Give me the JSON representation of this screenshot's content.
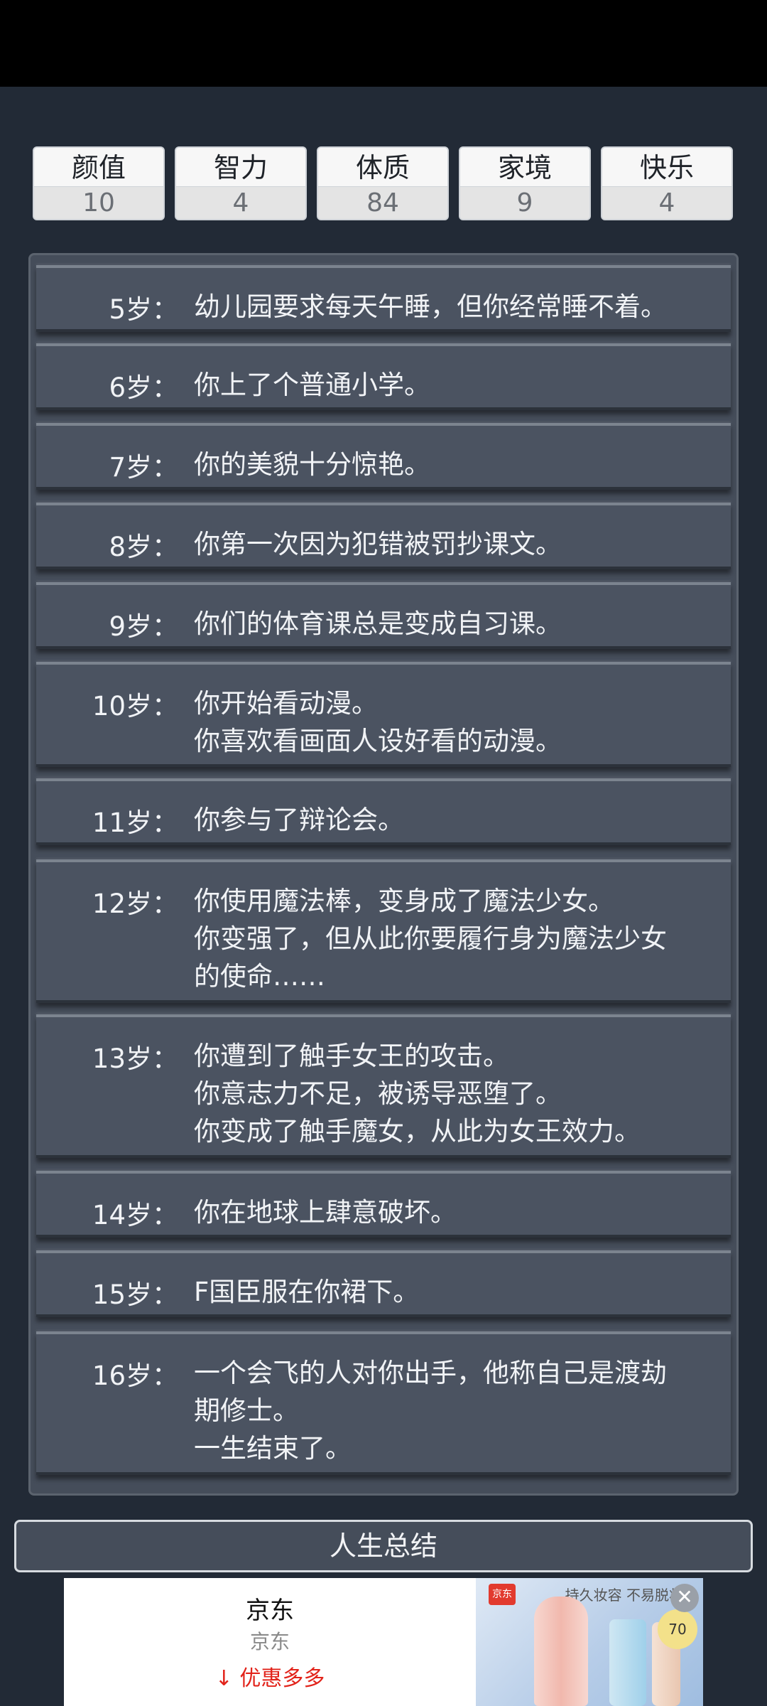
{
  "stats": [
    {
      "name": "颜值",
      "value": "10"
    },
    {
      "name": "智力",
      "value": "4"
    },
    {
      "name": "体质",
      "value": "84"
    },
    {
      "name": "家境",
      "value": "9"
    },
    {
      "name": "快乐",
      "value": "4"
    }
  ],
  "entries": [
    {
      "age": "5岁：",
      "lines": [
        "幼儿园要求每天午睡，但你经常睡不着。"
      ]
    },
    {
      "age": "6岁：",
      "lines": [
        "你上了个普通小学。"
      ]
    },
    {
      "age": "7岁：",
      "lines": [
        "你的美貌十分惊艳。"
      ]
    },
    {
      "age": "8岁：",
      "lines": [
        "你第一次因为犯错被罚抄课文。"
      ]
    },
    {
      "age": "9岁：",
      "lines": [
        "你们的体育课总是变成自习课。"
      ]
    },
    {
      "age": "10岁：",
      "lines": [
        "你开始看动漫。",
        "你喜欢看画面人设好看的动漫。"
      ]
    },
    {
      "age": "11岁：",
      "lines": [
        "你参与了辩论会。"
      ]
    },
    {
      "age": "12岁：",
      "lines": [
        "你使用魔法棒，变身成了魔法少女。",
        "你变强了，但从此你要履行身为魔法少女",
        "的使命……"
      ]
    },
    {
      "age": "13岁：",
      "lines": [
        "你遭到了触手女王的攻击。",
        "你意志力不足，被诱导恶堕了。",
        "你变成了触手魔女，从此为女王效力。"
      ]
    },
    {
      "age": "14岁：",
      "lines": [
        "你在地球上肆意破坏。"
      ]
    },
    {
      "age": "15岁：",
      "lines": [
        "F国臣服在你裙下。"
      ]
    },
    {
      "age": "16岁：",
      "lines": [
        "一个会飞的人对你出手，他称自己是渡劫",
        "期修士。",
        "一生结束了。"
      ]
    }
  ],
  "summary_button": "人生总结",
  "ad": {
    "title": "京东",
    "subtitle": "京东",
    "cta": "↓ 优惠多多",
    "image_tagline": "持久妆容 不易脱妆",
    "image_brand": "京东",
    "image_price": "70",
    "close_icon": "✕"
  }
}
